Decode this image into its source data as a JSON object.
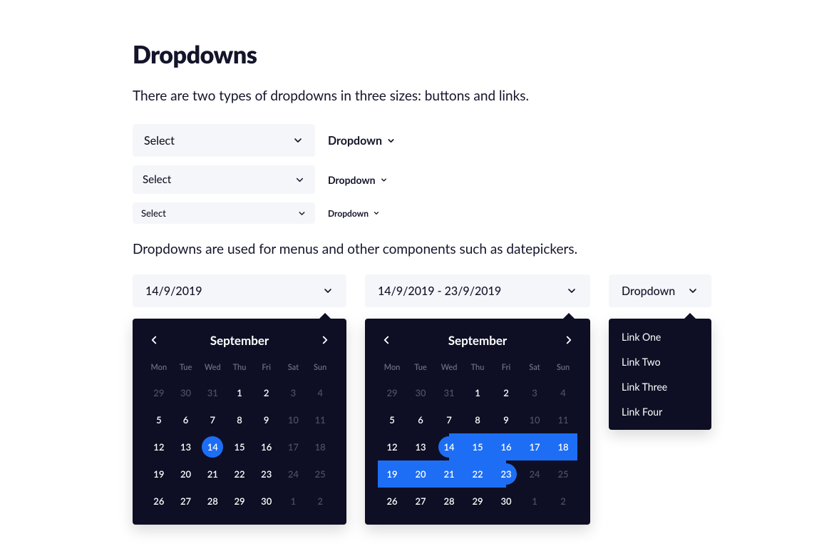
{
  "title": "Dropdowns",
  "intro": "There are two types of dropdowns in three sizes: buttons and links.",
  "select": {
    "label": "Select"
  },
  "link": {
    "label": "Dropdown"
  },
  "subintro": "Dropdowns are used for menus and other components such as datepickers.",
  "date1": {
    "value": "14/9/2019"
  },
  "date2": {
    "value": "14/9/2019 - 23/9/2019"
  },
  "dd3": {
    "label": "Dropdown"
  },
  "calendar": {
    "month": "September",
    "dow": [
      "Mon",
      "Tue",
      "Wed",
      "Thu",
      "Fri",
      "Sat",
      "Sun"
    ],
    "weeks": [
      [
        {
          "n": 29,
          "m": true
        },
        {
          "n": 30,
          "m": true
        },
        {
          "n": 31,
          "m": true
        },
        {
          "n": 1
        },
        {
          "n": 2
        },
        {
          "n": 3,
          "m": true
        },
        {
          "n": 4,
          "m": true
        }
      ],
      [
        {
          "n": 5
        },
        {
          "n": 6
        },
        {
          "n": 7
        },
        {
          "n": 8
        },
        {
          "n": 9
        },
        {
          "n": 10,
          "m": true
        },
        {
          "n": 11,
          "m": true
        }
      ],
      [
        {
          "n": 12
        },
        {
          "n": 13
        },
        {
          "n": 14,
          "sel": true
        },
        {
          "n": 15
        },
        {
          "n": 16
        },
        {
          "n": 17,
          "m": true
        },
        {
          "n": 18,
          "m": true
        }
      ],
      [
        {
          "n": 19
        },
        {
          "n": 20
        },
        {
          "n": 21
        },
        {
          "n": 22
        },
        {
          "n": 23
        },
        {
          "n": 24,
          "m": true
        },
        {
          "n": 25,
          "m": true
        }
      ],
      [
        {
          "n": 26
        },
        {
          "n": 27
        },
        {
          "n": 28
        },
        {
          "n": 29
        },
        {
          "n": 30
        },
        {
          "n": 1,
          "m": true
        },
        {
          "n": 2,
          "m": true
        }
      ]
    ]
  },
  "calendar2": {
    "month": "September",
    "dow": [
      "Mon",
      "Tue",
      "Wed",
      "Thu",
      "Fri",
      "Sat",
      "Sun"
    ],
    "weeks": [
      [
        {
          "n": 29,
          "m": true
        },
        {
          "n": 30,
          "m": true
        },
        {
          "n": 31,
          "m": true
        },
        {
          "n": 1
        },
        {
          "n": 2
        },
        {
          "n": 3,
          "m": true
        },
        {
          "n": 4,
          "m": true
        }
      ],
      [
        {
          "n": 5
        },
        {
          "n": 6
        },
        {
          "n": 7
        },
        {
          "n": 8
        },
        {
          "n": 9
        },
        {
          "n": 10,
          "m": true
        },
        {
          "n": 11,
          "m": true
        }
      ],
      [
        {
          "n": 12
        },
        {
          "n": 13
        },
        {
          "n": 14,
          "rs": true
        },
        {
          "n": 15,
          "r": true
        },
        {
          "n": 16,
          "r": true
        },
        {
          "n": 17,
          "r": true
        },
        {
          "n": 18,
          "r": true
        }
      ],
      [
        {
          "n": 19,
          "r": true
        },
        {
          "n": 20,
          "r": true
        },
        {
          "n": 21,
          "r": true
        },
        {
          "n": 22,
          "r": true
        },
        {
          "n": 23,
          "re": true
        },
        {
          "n": 24,
          "m": true
        },
        {
          "n": 25,
          "m": true
        }
      ],
      [
        {
          "n": 26
        },
        {
          "n": 27
        },
        {
          "n": 28
        },
        {
          "n": 29
        },
        {
          "n": 30
        },
        {
          "n": 1,
          "m": true
        },
        {
          "n": 2,
          "m": true
        }
      ]
    ]
  },
  "menu": {
    "items": [
      "Link One",
      "Link Two",
      "Link Three",
      "Link Four"
    ]
  }
}
